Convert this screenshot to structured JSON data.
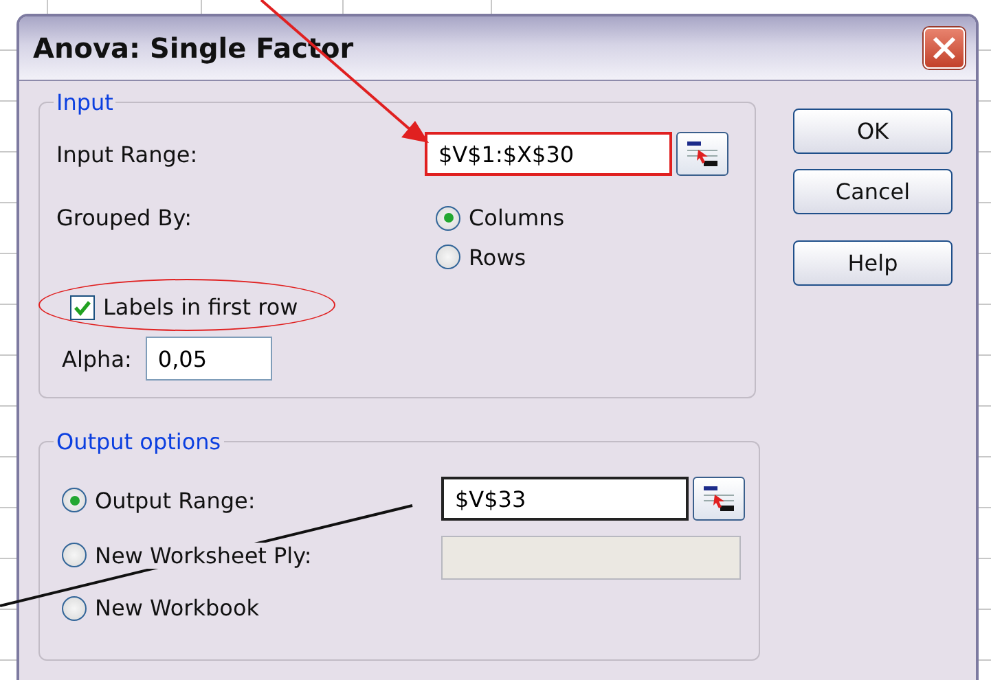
{
  "window": {
    "title": "Anova: Single Factor"
  },
  "input": {
    "legend": "Input",
    "range": {
      "label": "Input Range:",
      "value": "$V$1:$X$30",
      "highlighted": true
    },
    "grouped_by": {
      "label": "Grouped By:",
      "options": [
        {
          "label": "Columns",
          "selected": true
        },
        {
          "label": "Rows",
          "selected": false
        }
      ]
    },
    "labels_in_first_row": {
      "label": "Labels in first row",
      "checked": true,
      "circled": true
    },
    "alpha": {
      "label": "Alpha:",
      "value": "0,05"
    }
  },
  "output": {
    "legend": "Output options",
    "options": [
      {
        "kind": "range",
        "label": "Output Range:",
        "selected": true,
        "value": "$V$33"
      },
      {
        "kind": "sheet",
        "label": "New Worksheet Ply:",
        "selected": false,
        "field_disabled": true
      },
      {
        "kind": "plain",
        "label": "New Workbook",
        "selected": false
      }
    ]
  },
  "buttons": [
    {
      "label": "OK"
    },
    {
      "label": "Cancel"
    },
    {
      "label": "Help"
    }
  ]
}
